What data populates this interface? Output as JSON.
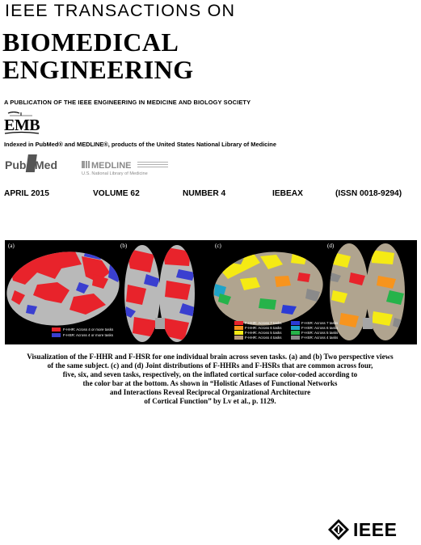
{
  "journal": {
    "top_line": "IEEE TRANSACTIONS ON",
    "title_lines": [
      "BIOMEDICAL",
      "ENGINEERING"
    ],
    "society_line": "A PUBLICATION OF THE IEEE ENGINEERING IN MEDICINE AND BIOLOGY SOCIETY"
  },
  "emb_logo_text": "EMB",
  "indexed_line": "Indexed in PubMed® and MEDLINE®, products of the United States National Library of Medicine",
  "pubmed_logo": {
    "pub": "Pub",
    "med": "Med"
  },
  "medline_logo": {
    "name": "MEDLINE",
    "sub": "U.S. National Library of Medicine"
  },
  "issue": {
    "date": "APRIL 2015",
    "volume": "VOLUME 62",
    "number": "NUMBER 4",
    "code": "IEBEAX",
    "issn": "(ISSN 0018-9294)"
  },
  "figure": {
    "panel_labels": [
      "(a)",
      "(b)",
      "(c)",
      "(d)"
    ],
    "legend_left": [
      {
        "label": "F-HHR: Across 4 or more tasks",
        "color": "#e8232b"
      },
      {
        "label": "F-HSR: Across 4 or more tasks",
        "color": "#3a3fd0"
      }
    ],
    "legend_right": [
      {
        "label": "F-HHR: Across 7 tasks",
        "color": "#e8232b"
      },
      {
        "label": "F-HHR: Across 6 tasks",
        "color": "#f7941d"
      },
      {
        "label": "F-HHR: Across 5 tasks",
        "color": "#f5ea14"
      },
      {
        "label": "F-HHR: Across 4 tasks",
        "color": "#b89a7a"
      },
      {
        "label": "F-HSR: Across 7 tasks",
        "color": "#2b3bd6"
      },
      {
        "label": "F-HSR: Across 6 tasks",
        "color": "#1fa3c8"
      },
      {
        "label": "F-HSR: Across 5 tasks",
        "color": "#26b34a"
      },
      {
        "label": "F-HSR: Across 4 tasks",
        "color": "#8a8a8a"
      }
    ]
  },
  "caption_lines": [
    "Visualization of the F-HHR and F-HSR for one individual brain across seven tasks. (a) and (b) Two perspective views",
    "of the same subject. (c) and (d) Joint distributions of F-HHRs and F-HSRs that are common across four,",
    "five, six, and seven tasks, respectively, on the inflated cortical surface color-coded according to",
    "the color bar at the bottom. As shown in “Holistic Atlases of Functional Networks",
    "and Interactions Reveal Reciprocal Organizational Architecture",
    "of Cortical Function” by Lv et al., p. 1129."
  ],
  "ieee_logo_text": "IEEE",
  "colors": {
    "red": "#e8232b",
    "blue": "#3a3fd0",
    "brain_gray": "#b9b9b9"
  }
}
